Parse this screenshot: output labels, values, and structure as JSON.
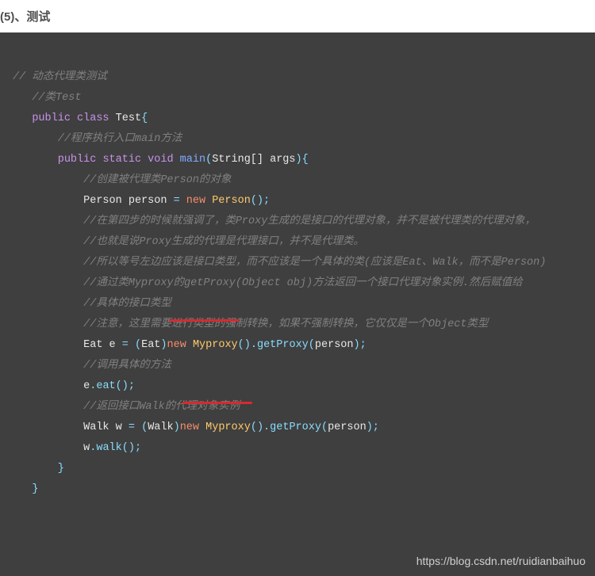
{
  "heading": "(5)、测试",
  "code": {
    "c1": "// 动态代理类测试",
    "c2": "//类Test",
    "kw_public1": "public",
    "kw_class": "class",
    "classname": "Test",
    "brace_open": "{",
    "c3": "//程序执行入口main方法",
    "kw_public2": "public",
    "kw_static": "static",
    "kw_void": "void",
    "main": "main",
    "p_open1": "(",
    "string_arr": "String[] args",
    "p_close1": ")",
    "brace_open2": "{",
    "c4": "//创建被代理类Person的对象",
    "person_decl_type": "Person",
    "person_decl_var": "person",
    "eq": "=",
    "new1": "new",
    "person_ctor": "Person",
    "empty_parens": "()",
    "semi": ";",
    "c5": "//在第四步的时候就强调了，类Proxy生成的是接口的代理对象，并不是被代理类的代理对象，",
    "c6": "//也就是说Proxy生成的代理是代理接口，并不是代理类。",
    "c7": "//所以等号左边应该是接口类型，而不应该是一个具体的类(应该是Eat、Walk，而不是Person)",
    "c8": "//通过类Myproxy的getProxy(Object obj)方法返回一个接口代理对象实例.然后赋值给",
    "c9": "//具体的接口类型",
    "c10": "//注意，这里需要进行类型的强制转换，如果不强制转换，它仅仅是一个Object类型",
    "eat_type": "Eat",
    "eat_var": "e",
    "cast_eat": "Eat",
    "new2": "new",
    "myproxy": "Myproxy",
    "getproxy": "getProxy",
    "person_arg": "person",
    "c11": "//调用具体的方法",
    "eat_call_obj": "e",
    "eat_call": "eat",
    "c12": "//返回接口Walk的代理对象实例",
    "walk_type": "Walk",
    "walk_var": "w",
    "cast_walk": "Walk",
    "new3": "new",
    "walk_call_obj": "w",
    "walk_call": "walk",
    "brace_close": "}"
  },
  "watermark": "https://blog.csdn.net/ruidianbaihuo"
}
